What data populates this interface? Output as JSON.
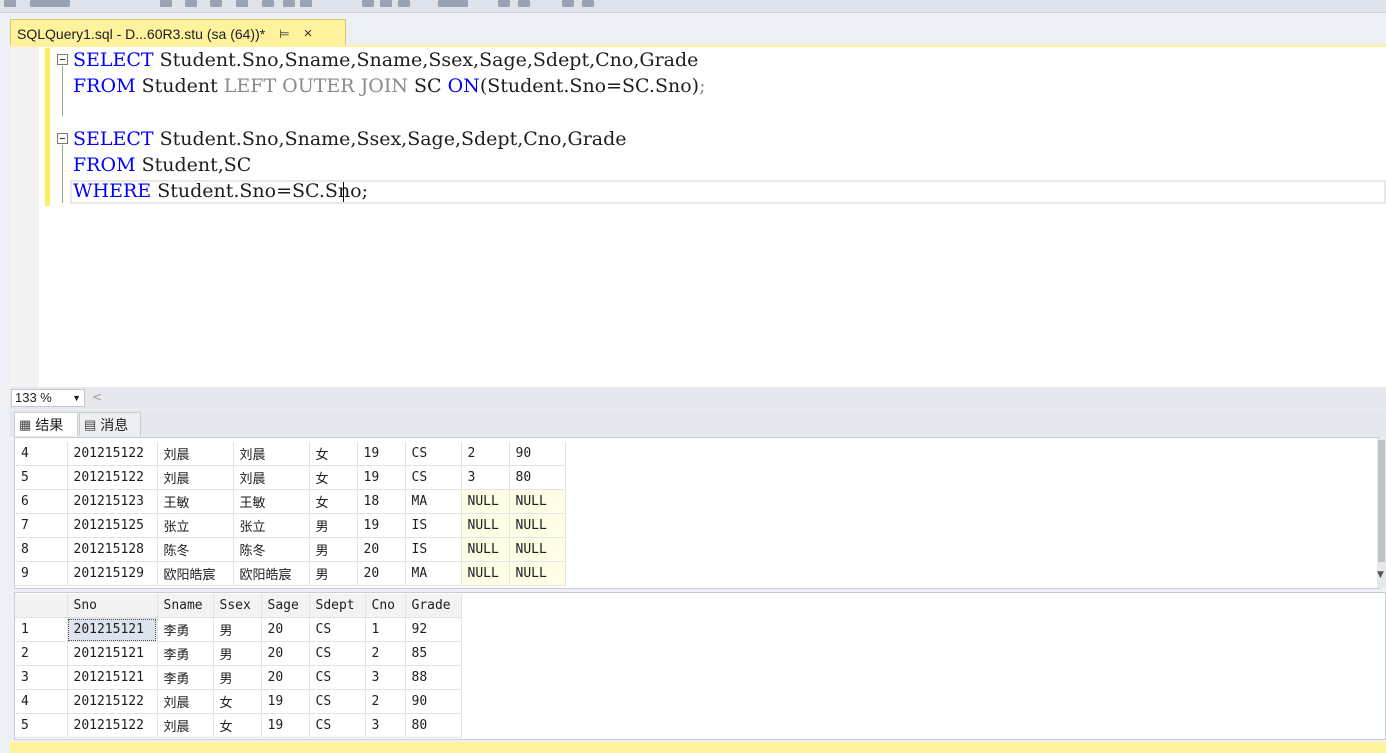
{
  "tab": {
    "title": "SQLQuery1.sql - D...60R3.stu (sa (64))*",
    "pin": "⊨",
    "close": "×"
  },
  "editor": {
    "lines": [
      {
        "parts": [
          {
            "t": "SELECT",
            "c": "kw"
          },
          {
            "t": " Student.Sno,Sname,Sname,Ssex,Sage,Sdept,Cno,Grade",
            "c": ""
          }
        ]
      },
      {
        "parts": [
          {
            "t": "FROM",
            "c": "kw"
          },
          {
            "t": " Student ",
            "c": ""
          },
          {
            "t": "LEFT OUTER JOIN",
            "c": "gy"
          },
          {
            "t": " SC ",
            "c": ""
          },
          {
            "t": "ON",
            "c": "kw"
          },
          {
            "t": "(Student.Sno=SC.Sno)",
            "c": ""
          },
          {
            "t": ";",
            "c": "gy"
          }
        ]
      },
      {
        "parts": []
      },
      {
        "parts": [
          {
            "t": "SELECT",
            "c": "kw"
          },
          {
            "t": " Student.Sno,Sname,Ssex,Sage,Sdept,Cno,Grade",
            "c": ""
          }
        ]
      },
      {
        "parts": [
          {
            "t": "FROM",
            "c": "kw"
          },
          {
            "t": " Student,SC",
            "c": ""
          }
        ]
      },
      {
        "parts": [
          {
            "t": "WHERE",
            "c": "kw"
          },
          {
            "t": " Student.Sno=SC.Sno;",
            "c": ""
          }
        ]
      }
    ]
  },
  "zoom": {
    "value": "133 %",
    "dropdown_icon": "triangle-down-icon"
  },
  "results_tabs": [
    {
      "label": "结果",
      "icon": "grid-icon"
    },
    {
      "label": "消息",
      "icon": "message-icon"
    }
  ],
  "grid1": {
    "rows": [
      [
        "4",
        "201215122",
        "刘晨",
        "刘晨",
        "女",
        "19",
        "CS",
        "2",
        "90"
      ],
      [
        "5",
        "201215122",
        "刘晨",
        "刘晨",
        "女",
        "19",
        "CS",
        "3",
        "80"
      ],
      [
        "6",
        "201215123",
        "王敏",
        "王敏",
        "女",
        "18",
        "MA",
        "NULL",
        "NULL"
      ],
      [
        "7",
        "201215125",
        "张立",
        "张立",
        "男",
        "19",
        "IS",
        "NULL",
        "NULL"
      ],
      [
        "8",
        "201215128",
        "陈冬",
        "陈冬",
        "男",
        "20",
        "IS",
        "NULL",
        "NULL"
      ],
      [
        "9",
        "201215129",
        "欧阳皓宸",
        "欧阳皓宸",
        "男",
        "20",
        "MA",
        "NULL",
        "NULL"
      ]
    ]
  },
  "grid2": {
    "headers": [
      "",
      "Sno",
      "Sname",
      "Ssex",
      "Sage",
      "Sdept",
      "Cno",
      "Grade"
    ],
    "rows": [
      [
        "1",
        "201215121",
        "李勇",
        "男",
        "20",
        "CS",
        "1",
        "92"
      ],
      [
        "2",
        "201215121",
        "李勇",
        "男",
        "20",
        "CS",
        "2",
        "85"
      ],
      [
        "3",
        "201215121",
        "李勇",
        "男",
        "20",
        "CS",
        "3",
        "88"
      ],
      [
        "4",
        "201215122",
        "刘晨",
        "女",
        "19",
        "CS",
        "2",
        "90"
      ],
      [
        "5",
        "201215122",
        "刘晨",
        "女",
        "19",
        "CS",
        "3",
        "80"
      ]
    ]
  },
  "colors": {
    "tab_accent": "#fff29d",
    "keyword": "#0000ff",
    "gray_keyword": "#8a8a8a",
    "null_cell": "#fffde5"
  }
}
